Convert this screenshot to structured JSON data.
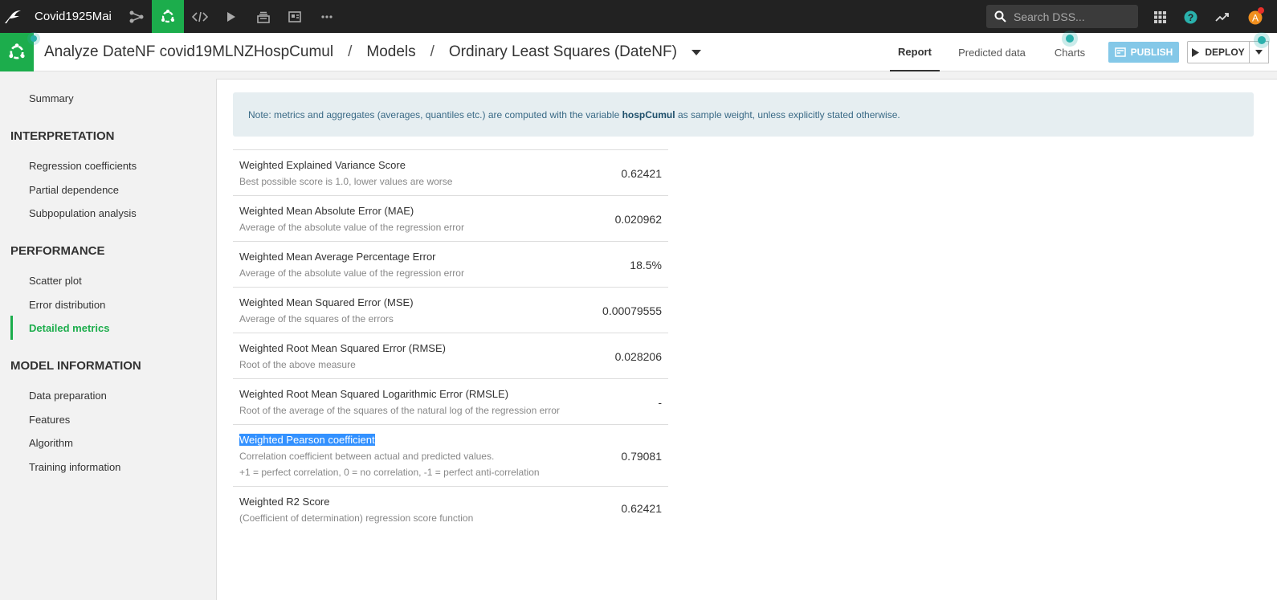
{
  "topnav": {
    "project_name": "Covid1925Mai",
    "search_placeholder": "Search DSS...",
    "avatar_letter": "A",
    "accent": "#1cad4c"
  },
  "breadcrumb": {
    "analysis": "Analyze DateNF covid19MLNZHospCumul",
    "models": "Models",
    "model": "Ordinary Least Squares (DateNF)"
  },
  "tabs": {
    "report": "Report",
    "predicted": "Predicted data",
    "charts": "Charts"
  },
  "actions": {
    "publish": "PUBLISH",
    "deploy": "DEPLOY"
  },
  "sidebar": {
    "summary": "Summary",
    "interpretation_heading": "INTERPRETATION",
    "interpretation": [
      "Regression coefficients",
      "Partial dependence",
      "Subpopulation analysis"
    ],
    "performance_heading": "PERFORMANCE",
    "performance": [
      "Scatter plot",
      "Error distribution",
      "Detailed metrics"
    ],
    "model_info_heading": "MODEL INFORMATION",
    "model_info": [
      "Data preparation",
      "Features",
      "Algorithm",
      "Training information"
    ]
  },
  "note": {
    "prefix": "Note: metrics and aggregates (averages, quantiles etc.) are computed with the variable",
    "variable": "hospCumul",
    "suffix": "as sample weight, unless explicitly stated otherwise."
  },
  "metrics": [
    {
      "title": "Weighted Explained Variance Score",
      "desc": "Best possible score is 1.0, lower values are worse",
      "value": "0.62421"
    },
    {
      "title": "Weighted Mean Absolute Error (MAE)",
      "desc": "Average of the absolute value of the regression error",
      "value": "0.020962"
    },
    {
      "title": "Weighted Mean Average Percentage Error",
      "desc": "Average of the absolute value of the regression error",
      "value": "18.5%"
    },
    {
      "title": "Weighted Mean Squared Error (MSE)",
      "desc": "Average of the squares of the errors",
      "value": "0.00079555"
    },
    {
      "title": "Weighted Root Mean Squared Error (RMSE)",
      "desc": "Root of the above measure",
      "value": "0.028206"
    },
    {
      "title": "Weighted Root Mean Squared Logarithmic Error (RMSLE)",
      "desc": "Root of the average of the squares of the natural log of the regression error",
      "value": "-"
    },
    {
      "title": "Weighted Pearson coefficient",
      "desc": "Correlation coefficient between actual and predicted values.",
      "desc2": "+1 = perfect correlation, 0 = no correlation, -1 = perfect anti-correlation",
      "value": "0.79081"
    },
    {
      "title": "Weighted R2 Score",
      "desc": "(Coefficient of determination) regression score function",
      "value": "0.62421"
    }
  ]
}
